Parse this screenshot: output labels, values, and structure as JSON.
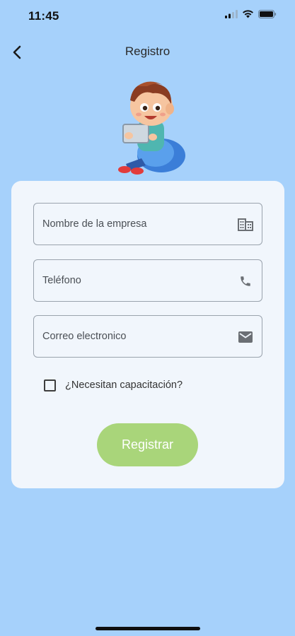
{
  "status_bar": {
    "time": "11:45"
  },
  "header": {
    "title": "Registro",
    "back_icon": "chevron-left-icon"
  },
  "illustration": {
    "subject": "boy-reading-tablet-on-beanbag"
  },
  "form": {
    "fields": [
      {
        "placeholder": "Nombre de la empresa",
        "value": "",
        "icon": "building-icon"
      },
      {
        "placeholder": "Teléfono",
        "value": "",
        "icon": "phone-icon"
      },
      {
        "placeholder": "Correo electronico",
        "value": "",
        "icon": "mail-icon"
      }
    ],
    "checkbox": {
      "label": "¿Necesitan capacitación?",
      "checked": false
    },
    "submit_label": "Registrar"
  },
  "colors": {
    "background": "#a6d1fb",
    "card": "#f1f6fc",
    "button": "#a9d57a"
  }
}
